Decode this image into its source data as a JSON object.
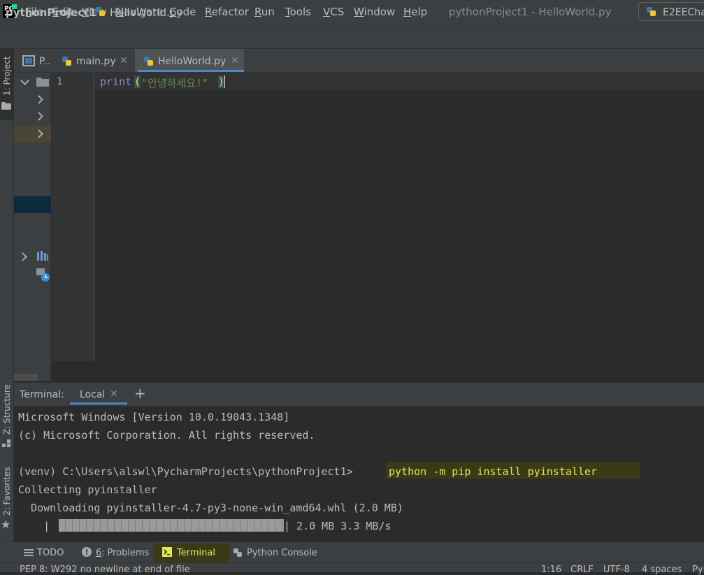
{
  "menubar": {
    "items": [
      "File",
      "Edit",
      "View",
      "Navigate",
      "Code",
      "Refactor",
      "Run",
      "Tools",
      "VCS",
      "Window",
      "Help"
    ],
    "window_title": "pythonProject1 - HelloWorld.py"
  },
  "navbar": {
    "project": "pythonProject1",
    "file": "HelloWorld.py",
    "run_config": "E2EECha"
  },
  "left_strip": {
    "project": "1: Project",
    "structure": "Z: Structure",
    "favorites": "2: Favorites"
  },
  "project_panel": {
    "header": "P..."
  },
  "tabs": [
    {
      "label": "main.py",
      "active": false
    },
    {
      "label": "HelloWorld.py",
      "active": true
    }
  ],
  "editor": {
    "line_number": "1",
    "code": {
      "func": "print",
      "open": "(",
      "string": "\"안녕하세요!\"",
      "close": ")"
    }
  },
  "terminal": {
    "title": "Terminal:",
    "tab": "Local",
    "lines": [
      "Microsoft Windows [Version 10.0.19043.1348]",
      "(c) Microsoft Corporation. All rights reserved.",
      "",
      "(venv) C:\\Users\\alswl\\PycharmProjects\\pythonProject1>",
      "Collecting pyinstaller",
      "  Downloading pyinstaller-4.7-py3-none-win_amd64.whl (2.0 MB)"
    ],
    "command": "python -m pip install pyinstaller",
    "progress_left": "    |",
    "progress_right": "| 2.0 MB 3.3 MB/s",
    "progress_fraction": 1.0
  },
  "bottom_bar": {
    "todo": "TODO",
    "problems_num": "6",
    "problems": ": Problems",
    "terminal": "Terminal",
    "python_console": "Python Console"
  },
  "status_bar": {
    "message": "PEP 8: W292 no newline at end of file",
    "position": "1:16",
    "line_sep": "CRLF",
    "encoding": "UTF-8",
    "indent": "4 spaces",
    "extra": "Py"
  },
  "colors": {
    "background": "#2b2b2b",
    "panel": "#3c3f41",
    "accent": "#4a88c7",
    "keyword": "#8888c6",
    "string": "#6a8759",
    "highlight": "#3a3a17"
  }
}
